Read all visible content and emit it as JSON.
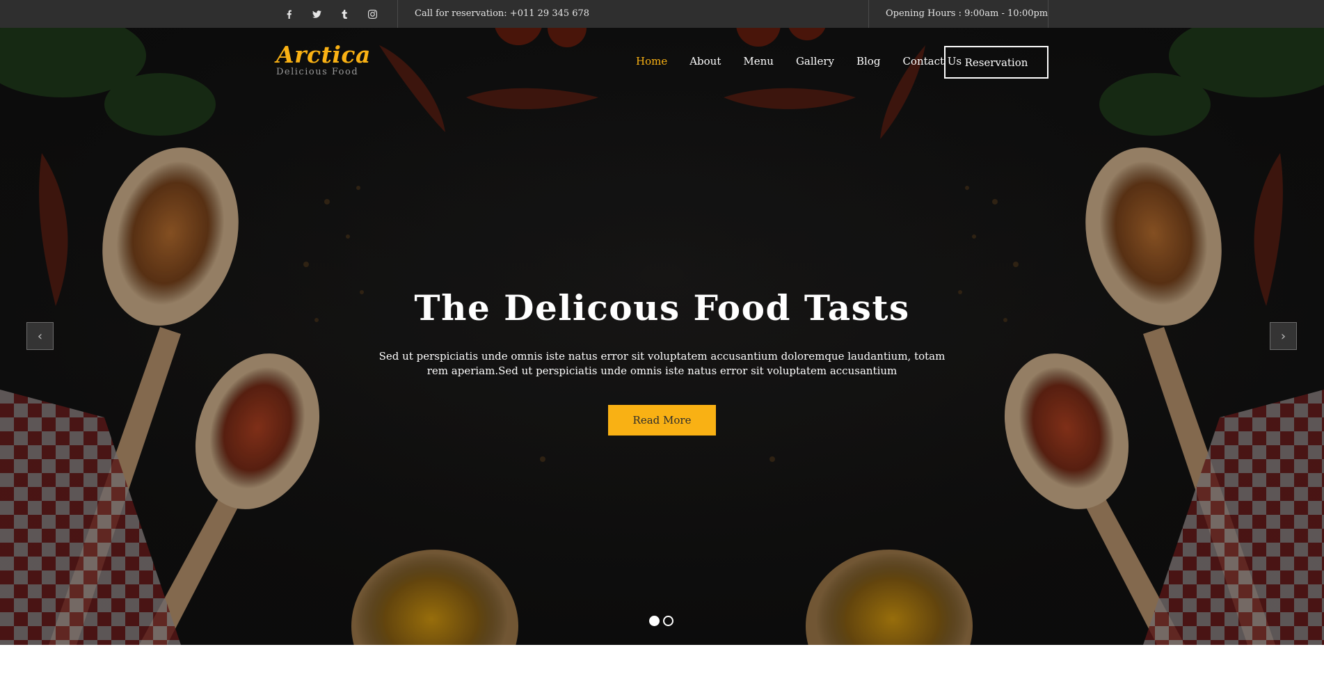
{
  "topbar": {
    "social": [
      {
        "icon": "facebook-icon",
        "glyph": "f"
      },
      {
        "icon": "twitter-icon",
        "glyph": ""
      },
      {
        "icon": "tumblr-icon",
        "glyph": "t"
      },
      {
        "icon": "instagram-icon",
        "glyph": ""
      }
    ],
    "phone": "Call for reservation: +011 29 345 678",
    "hours": "Opening Hours : 9:00am - 10:00pm"
  },
  "header": {
    "logo_name": "Arctica",
    "logo_tagline": "Delicious Food",
    "nav": [
      "Home",
      "About",
      "Menu",
      "Gallery",
      "Blog",
      "Contact Us"
    ],
    "active_nav": "Home",
    "reservation_label": "Reservation"
  },
  "hero": {
    "title": "The Delicous Food Tasts",
    "text": "Sed ut perspiciatis unde omnis iste natus error sit voluptatem accusantium doloremque laudantium, totam rem aperiam.Sed ut perspiciatis unde omnis iste natus error sit voluptatem accusantium",
    "button_label": "Read More",
    "prev_arrow": "‹",
    "next_arrow": "›",
    "slides_total": 2,
    "active_slide": 1
  },
  "colors": {
    "accent": "#f9b114",
    "topbar_bg": "#2f2f2f",
    "hero_bg": "#1a1918"
  }
}
